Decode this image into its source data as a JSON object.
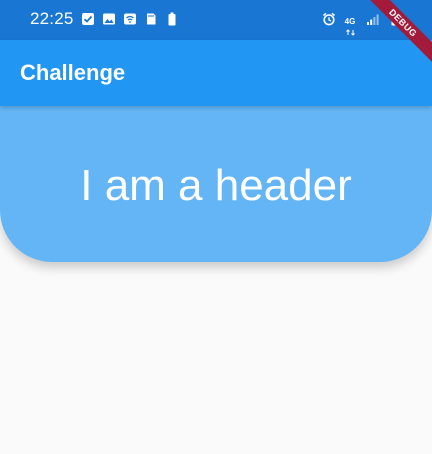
{
  "status_bar": {
    "time": "22:25",
    "network_label": "4G",
    "left_icons": [
      "check-icon",
      "image-icon",
      "wifi-icon",
      "sd-card-icon",
      "battery-icon"
    ],
    "right_icons": [
      "alarm-icon",
      "network-4g-icon",
      "signal-icon",
      "battery-icon"
    ]
  },
  "app_bar": {
    "title": "Challenge"
  },
  "header_card": {
    "text": "I am a header"
  },
  "debug_banner": {
    "label": "DEBUG"
  },
  "colors": {
    "status_bar": "#1976d2",
    "app_bar": "#2196f3",
    "header": "#64b5f6",
    "background": "#fafafa",
    "debug_banner": "#a31b3a"
  }
}
